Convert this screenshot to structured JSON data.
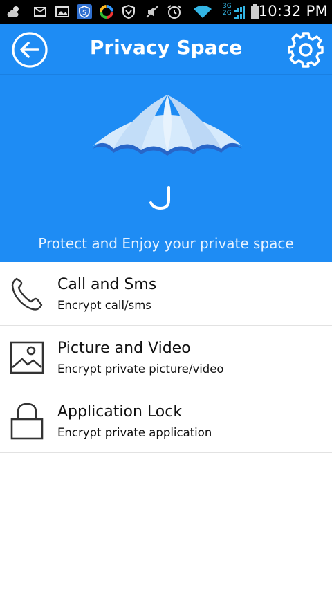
{
  "status_bar": {
    "network_3g": "3G",
    "network_2g": "2G",
    "time": "10:32 PM"
  },
  "header": {
    "title": "Privacy Space"
  },
  "banner": {
    "tagline": "Protect and Enjoy your private space"
  },
  "menu": [
    {
      "icon": "phone-icon",
      "title": "Call and Sms",
      "subtitle": "Encrypt call/sms"
    },
    {
      "icon": "picture-icon",
      "title": "Picture and Video",
      "subtitle": "Encrypt private picture/video"
    },
    {
      "icon": "lock-icon",
      "title": "Application Lock",
      "subtitle": "Encrypt private application"
    }
  ],
  "colors": {
    "primary": "#1e8cf4",
    "umbrella_light": "#cfe6fb",
    "umbrella_dark": "#2866c8"
  }
}
